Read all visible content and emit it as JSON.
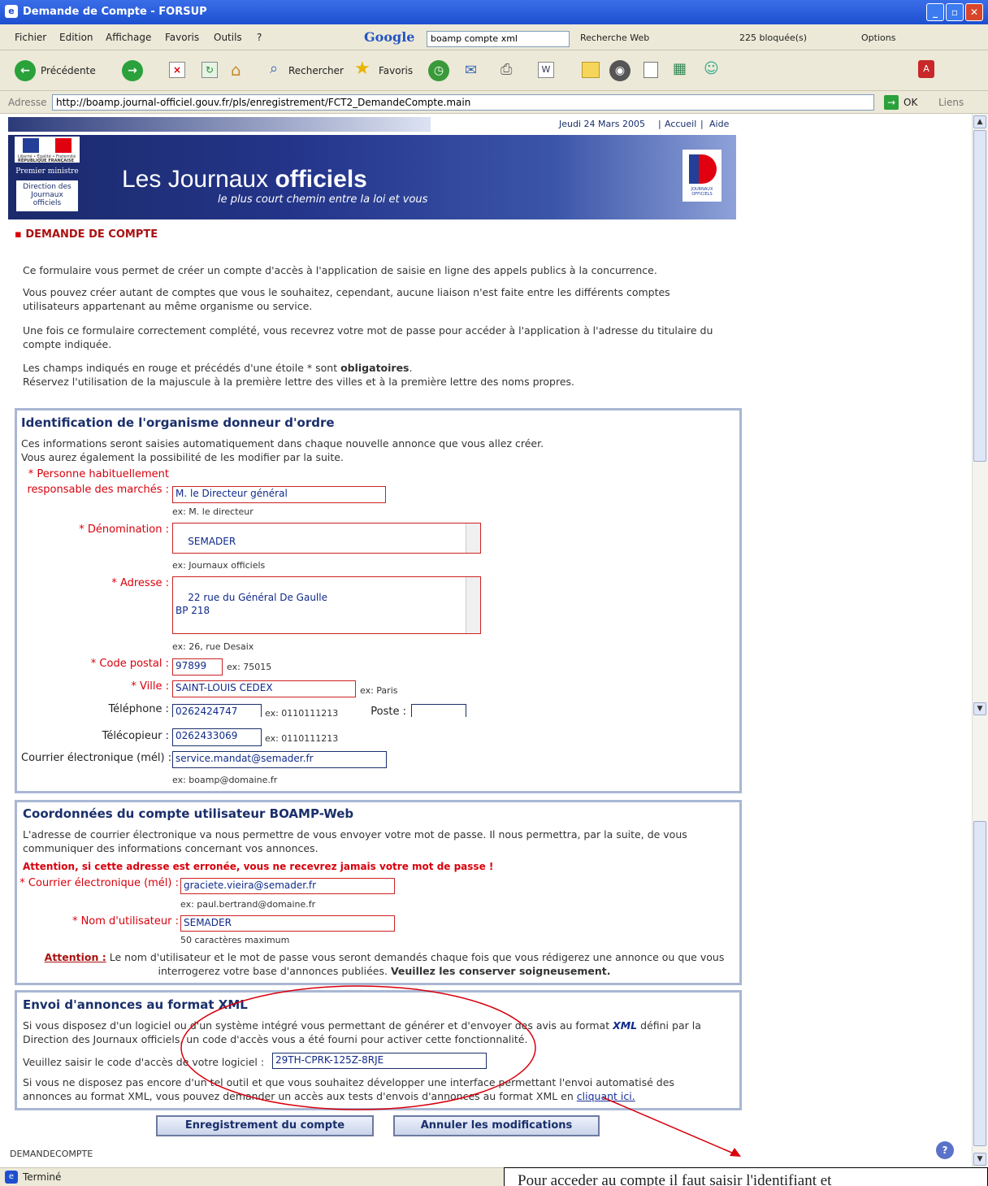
{
  "window": {
    "title": "Demande de Compte - FORSUP"
  },
  "menu": [
    "Fichier",
    "Edition",
    "Affichage",
    "Favoris",
    "Outils",
    "?"
  ],
  "google": {
    "logo": "Google",
    "query": "boamp compte xml",
    "search": "Recherche Web",
    "blocked": "225 bloquée(s)",
    "options": "Options"
  },
  "toolbar": {
    "back": "Précédente",
    "search": "Rechercher",
    "favorites": "Favoris"
  },
  "address": {
    "label": "Adresse",
    "url": "http://boamp.journal-officiel.gouv.fr/pls/enregistrement/FCT2_DemandeCompte.main",
    "go": "OK",
    "links": "Liens"
  },
  "header": {
    "date": "Jeudi 24 Mars 2005",
    "home": "Accueil",
    "help": "Aide",
    "brand1": "Les Journaux",
    "brand2": "officiels",
    "tagline": "le plus court chemin entre la loi et vous",
    "pm": "Premier ministre",
    "dir": "Direction des Journaux officiels",
    "rf": "RÉPUBLIQUE FRANÇAISE",
    "liberte": "Liberté • Égalité • Fraternité",
    "jo": "JOURNAUX OFFICIELS"
  },
  "page": {
    "heading": "DEMANDE DE COMPTE",
    "p1": "Ce formulaire vous permet de créer un compte d'accès à l'application de saisie en ligne des appels publics à la concurrence.",
    "p2": "Vous pouvez créer autant de comptes que vous le souhaitez, cependant, aucune liaison n'est faite entre les différents comptes utilisateurs appartenant au même organisme ou service.",
    "p3": "Une fois ce formulaire correctement complété, vous recevrez votre mot de passe pour accéder à l'application à l'adresse du titulaire du compte indiquée.",
    "warn1a": "Les champs indiqués en rouge et précédés d'une étoile * sont ",
    "warn1b": "obligatoires",
    "warn2": "Réservez l'utilisation de la majuscule à la première lettre des villes et à la première lettre des noms propres."
  },
  "org": {
    "title": "Identification de l'organisme donneur d'ordre",
    "intro1": "Ces informations seront saisies automatiquement dans chaque nouvelle annonce que vous allez créer.",
    "intro2": "Vous aurez également la possibilité de les modifier par la suite.",
    "resp_label1": "* Personne habituellement",
    "resp_label2": "responsable des marchés :",
    "resp_value": "M. le Directeur général",
    "resp_ex": "ex: M. le directeur",
    "denom_label": "* Dénomination :",
    "denom_value": "SEMADER",
    "denom_ex": "ex: Journaux officiels",
    "addr_label": "* Adresse :",
    "addr_value": "22 rue du Général De Gaulle\nBP 218",
    "addr_ex": "ex: 26, rue Desaix",
    "cp_label": "* Code postal :",
    "cp_value": "97899",
    "cp_ex": "ex: 75015",
    "ville_label": "* Ville :",
    "ville_value": "SAINT-LOUIS CEDEX",
    "ville_ex": "ex: Paris",
    "tel_label": "Téléphone :",
    "tel_value": "0262424747",
    "tel_ex": "ex: 0110111213",
    "poste_label": "Poste :",
    "poste_value": "",
    "fax_label": "Télécopieur :",
    "fax_value": "0262433069",
    "fax_ex": "ex: 0110111213",
    "mail_label": "Courrier électronique (mél) :",
    "mail_value": "service.mandat@semader.fr",
    "mail_ex": "ex: boamp@domaine.fr"
  },
  "user": {
    "title": "Coordonnées du compte utilisateur BOAMP-Web",
    "intro": "L'adresse de courrier électronique va nous permettre de vous envoyer votre mot de passe. Il nous permettra, par la suite, de vous communiquer des informations concernant vos annonces.",
    "warn": "Attention, si cette adresse est erronée, vous ne recevrez jamais votre mot de passe !",
    "mail_label": "* Courrier électronique (mél) :",
    "mail_value": "graciete.vieira@semader.fr",
    "mail_ex": "ex: paul.bertrand@domaine.fr",
    "name_label": "* Nom d'utilisateur :",
    "name_value": "SEMADER",
    "name_ex": "50 caractères maximum",
    "att_label": "Attention :",
    "att_text1": "Le nom d'utilisateur et le mot de passe vous seront demandés chaque fois que vous rédigerez une annonce ou que vous",
    "att_text2": "interrogerez votre base d'annonces publiées.",
    "att_bold": "Veuillez les conserver soigneusement."
  },
  "xml": {
    "title": "Envoi d'annonces au format XML",
    "p1a": "Si vous disposez d'un logiciel ou d'un système intégré vous permettant de générer et d'envoyer des avis au format",
    "xml": "XML",
    "p1b": "défini par la",
    "p1c": "Direction des Journaux officiels, un code d'accès vous a été fourni pour activer cette fonctionnalité.",
    "code_label": "Veuillez saisir le code d'accès de votre logiciel :",
    "code_value": "29TH-CPRK-125Z-8RJE",
    "p2a": "Si vous ne disposez pas encore d'un tel outil et que vous souhaitez développer une interface permettant l'envoi automatisé des",
    "p2b": "annonces au format XML, vous pouvez demander un accès aux tests d'envois d'annonces au format XML en",
    "p2link": "cliquant ici."
  },
  "buttons": {
    "submit": "Enregistrement du compte",
    "cancel": "Annuler les modifications"
  },
  "footer": {
    "code": "DEMANDECOMPTE"
  },
  "status": {
    "text": "Terminé"
  },
  "annotation": {
    "text": "Pour acceder au compte il faut saisir l'identifiant et"
  }
}
